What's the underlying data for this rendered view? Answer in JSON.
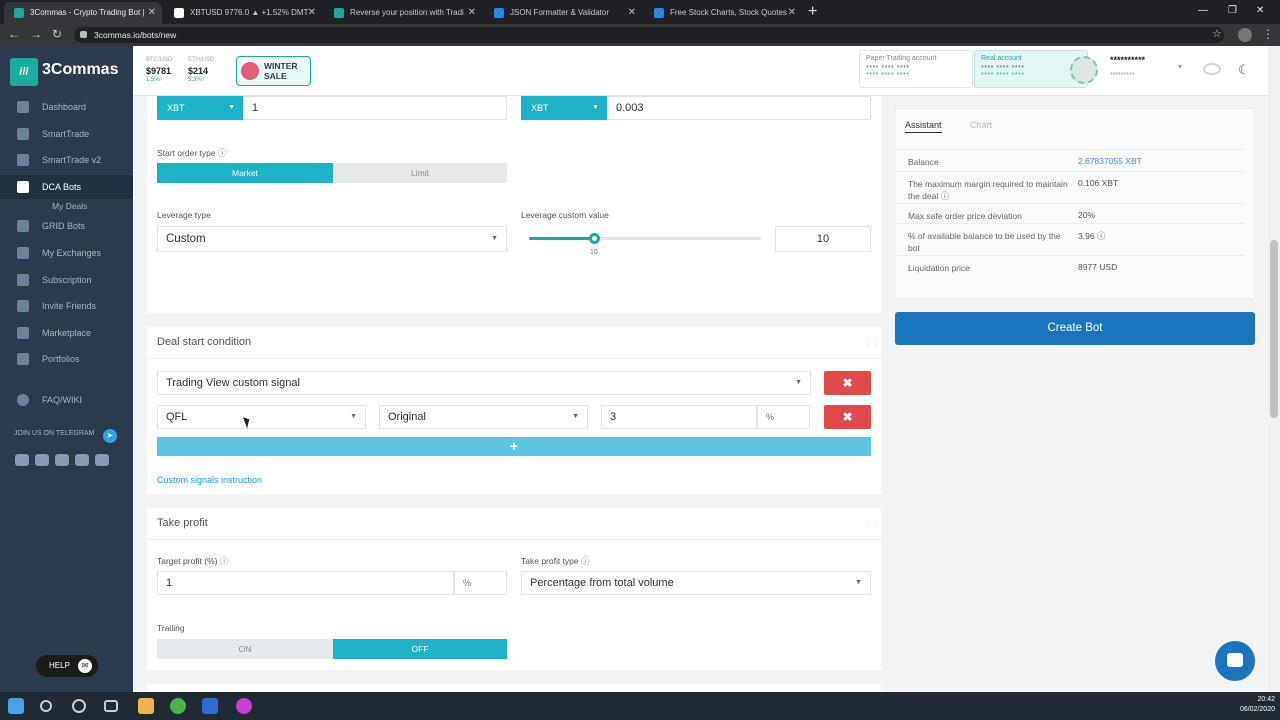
{
  "browser": {
    "tabs": [
      {
        "title": "3Commas - Crypto Trading Bot |",
        "fav": "#1aab9b"
      },
      {
        "title": "XBTUSD 9776.0 ▲ +1.52% DMT",
        "fav": "#fff"
      },
      {
        "title": "Reverse your position with Tradi",
        "fav": "#1aab9b"
      },
      {
        "title": "JSON Formatter & Validator",
        "fav": "#2a8adf"
      },
      {
        "title": "Free Stock Charts, Stock Quotes",
        "fav": "#2a8adf"
      }
    ],
    "new_tab": "+",
    "url": "3commas.io/bots/new",
    "win_min": "—",
    "win_max": "❐",
    "win_close": "✕"
  },
  "sidebar": {
    "logo_mark": "///",
    "logo_text": "3Commas",
    "items": [
      {
        "label": "Dashboard"
      },
      {
        "label": "SmartTrade"
      },
      {
        "label": "SmartTrade v2"
      },
      {
        "label": "DCA Bots"
      },
      {
        "label": "GRID Bots"
      },
      {
        "label": "My Exchanges"
      },
      {
        "label": "Subscription"
      },
      {
        "label": "Invite Friends"
      },
      {
        "label": "Marketplace"
      },
      {
        "label": "Portfolios"
      },
      {
        "label": "FAQ/WIKI"
      }
    ],
    "sub_item": "My Deals",
    "telegram": "JOIN US ON TELEGRAM",
    "help": "HELP"
  },
  "header": {
    "btc_label": "BTC/USD",
    "btc_price": "$9781",
    "btc_change": "1.5%↑",
    "eth_label": "ETH/USD",
    "eth_price": "$214",
    "eth_change": "5.3%↑",
    "sale_line1": "WINTER",
    "sale_line2": "SALE",
    "paper_account": "Paper Trading account",
    "paper_stars1": "**** **** ****",
    "paper_stars2": "**** **** ****",
    "real_account": "Real account",
    "real_stars1": "**** **** ****",
    "real_stars2": "**** **** ****",
    "username": "**********",
    "user_sub": "*********"
  },
  "form": {
    "base_currency": "XBT",
    "base_value": "1",
    "order_currency": "XBT",
    "order_value": "0.003",
    "start_order_type_label": "Start order type",
    "start_order_options": [
      "Market",
      "Limit"
    ],
    "leverage_type_label": "Leverage type",
    "leverage_type_value": "Custom",
    "leverage_custom_label": "Leverage custom value",
    "leverage_value": 10,
    "leverage_value_text": "10",
    "leverage_max": 100,
    "slider_tick": "10",
    "deal_start_title": "Deal start condition",
    "signal_type": "Trading View custom signal",
    "signal_pair": "QFL",
    "signal_mode": "Original",
    "signal_percent": "3",
    "percent_unit": "%",
    "remove": "✖",
    "add": "+",
    "custom_signals_link": "Custom signals instruction",
    "take_profit_title": "Take profit",
    "target_profit_label": "Target profit (%)",
    "target_profit_value": "1",
    "take_profit_type_label": "Take profit type",
    "take_profit_type_value": "Percentage from total volume",
    "trailing_label": "Trailing",
    "trailing_options": [
      "ON",
      "OFF"
    ]
  },
  "assistant": {
    "tabs": [
      "Assistant",
      "Chart"
    ],
    "rows": [
      {
        "key": "Balance",
        "value": "2.67837055 XBT"
      },
      {
        "key": "The maximum margin required to maintain the deal",
        "value": "0.106 XBT"
      },
      {
        "key": "Max safe order price deviation",
        "value": "20%"
      },
      {
        "key": "% of available balance to be used by the bot",
        "value": "3.96"
      },
      {
        "key": "Liquidation price",
        "value": "8977 USD"
      }
    ],
    "create_button": "Create Bot"
  },
  "taskbar": {
    "time": "20:42",
    "date": "06/02/2020"
  },
  "colors": {
    "accent": "#1aab9b",
    "signal_blue": "#1cb3c8",
    "danger": "#e04a4a",
    "primary": "#1b75bc"
  }
}
